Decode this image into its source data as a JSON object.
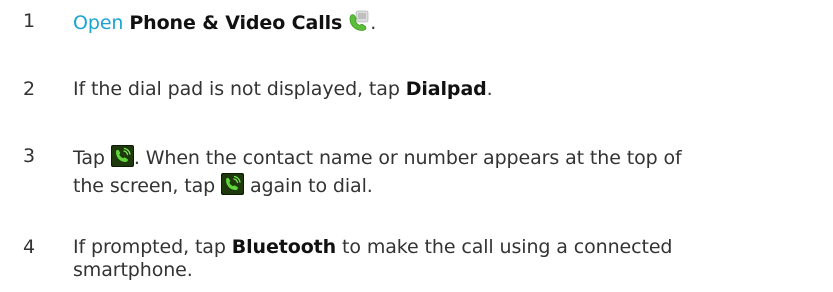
{
  "steps": [
    {
      "number": "1",
      "link_text": "Open",
      "space1": " ",
      "bold_text": "Phone & Video Calls",
      "icon": "phone-video-calls-app-icon",
      "end": "."
    },
    {
      "number": "2",
      "text_before": "If the dial pad is not displayed, tap ",
      "bold_text": "Dialpad",
      "end": "."
    },
    {
      "number": "3",
      "text_a": "Tap ",
      "icon": "green-call-button-icon",
      "text_b": ". When the contact name or number appears at the top of",
      "text_c": "the screen, tap ",
      "icon2": "green-call-button-icon",
      "text_d": " again to dial."
    },
    {
      "number": "4",
      "text_before": "If prompted, tap ",
      "bold_text": "Bluetooth",
      "text_after": " to make the call using a connected",
      "text_line2": "smartphone."
    }
  ],
  "colors": {
    "link": "#1da3d3",
    "text": "#333333",
    "call_button_green": "#3aa52a"
  }
}
